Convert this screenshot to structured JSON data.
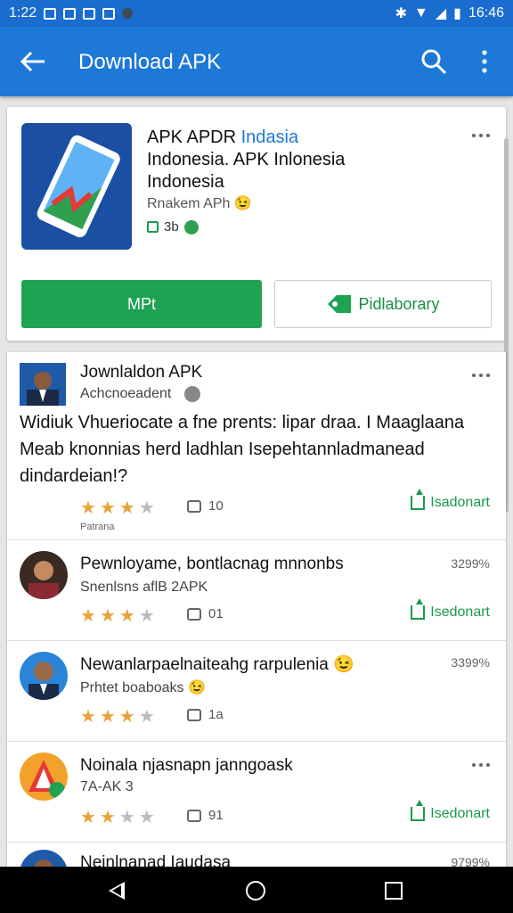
{
  "status_bar": {
    "time_left": "1:22",
    "time_right": "16:46"
  },
  "app_bar": {
    "title": "Download APK"
  },
  "app_card": {
    "title_part1": "APK APDR ",
    "title_highlight": "Indasia",
    "title_line2": "Indonesia. APK Inlonesia",
    "title_line3": "Indonesia",
    "subtitle": "Rnakem APh",
    "meta_count": "3b",
    "primary_button": "MPt",
    "secondary_button": "Pidlaborary"
  },
  "featured_review": {
    "name": "Jownlaldon APK",
    "subtitle": "Achcnoeadent",
    "body": "Widiuk Vhueriocate a fne prents: lipar draa. I Maaglaana Meab knonnias herd ladhlan Isepehtannladmanead dindardeian!?",
    "rating_label": "Patrana",
    "rating": 3,
    "comments": "10",
    "share": "Isadonart"
  },
  "reviews": [
    {
      "name": "Pewnloyame, bontlacnag mnnonbs",
      "subtitle": "Snenlsns aflB 2APK",
      "percent": "3299%",
      "rating": 3,
      "comments": "01",
      "share": "Isedonart"
    },
    {
      "name": "Newanlarpaelnaiteahg rarpulenia",
      "subtitle": "Prhtet boaboaks",
      "percent": "3399%",
      "rating": 3,
      "comments": "1a",
      "share": ""
    },
    {
      "name": "Noinala njasnapn janngoask",
      "subtitle": "7A-AK 3",
      "percent": "",
      "rating": 2,
      "comments": "91",
      "share": "Isedonart"
    },
    {
      "name": "Neinlnanad Iaudasa",
      "subtitle": "",
      "percent": "9799%",
      "rating": 0,
      "comments": "",
      "share": ""
    }
  ],
  "colors": {
    "primary": "#1d78d8",
    "accent_green": "#1fa352",
    "star": "#e8a33a"
  }
}
